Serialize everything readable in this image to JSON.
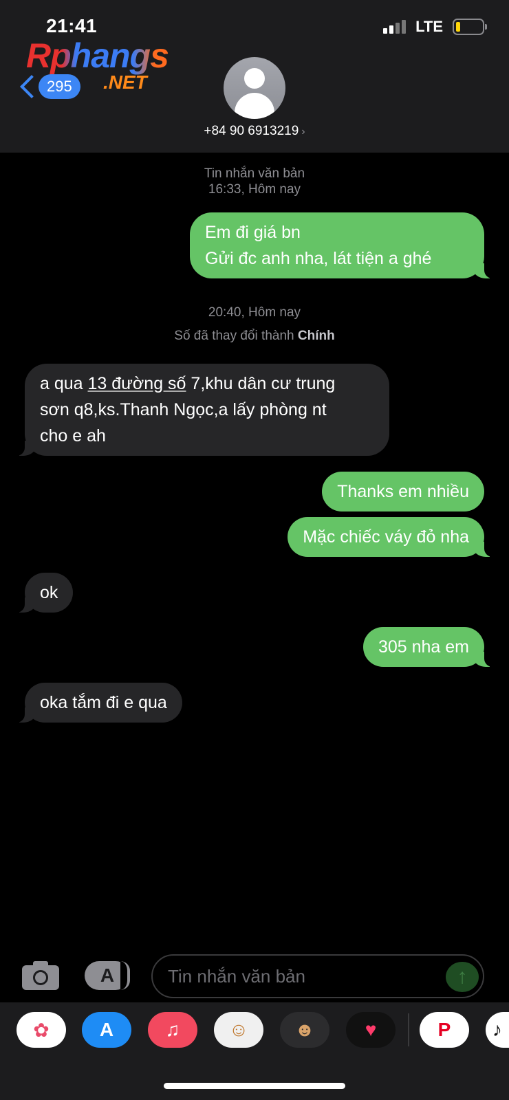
{
  "status_bar": {
    "time": "21:41",
    "network": "LTE"
  },
  "header": {
    "logo_main": "Rphangs",
    "logo_sub": ".NET",
    "back_badge": "295",
    "contact_number": "+84 90 6913219",
    "contact_arrow": "›"
  },
  "messages": {
    "meta1_line1": "Tin nhắn văn bản",
    "meta1_line2": "16:33, Hôm nay",
    "m1_line1": "Em đi giá bn",
    "m1_line2": "Gửi đc anh nha, lát tiện a ghé",
    "meta2_time": "20:40, Hôm nay",
    "meta2_prefix": "Số đã thay đổi thành ",
    "meta2_bold": "Chính",
    "m2_part1": "a qua ",
    "m2_link": "13 đường số",
    "m2_part2": " 7,khu dân cư trung",
    "m2_line2": "sơn q8,ks.Thanh Ngọc,a lấy phòng nt",
    "m2_line3": "cho e ah",
    "m3": "Thanks em nhiều",
    "m4": "Mặc chiếc váy đỏ nha",
    "m5": "ok",
    "m6": "305 nha em",
    "m7": "oka tắm đi e qua"
  },
  "input_bar": {
    "placeholder": "Tin nhắn văn bản",
    "send_glyph": "↑",
    "apps_glyph": "A"
  },
  "app_drawer": [
    {
      "name": "photos-app",
      "glyph": "✿"
    },
    {
      "name": "app-store-app",
      "glyph": "A"
    },
    {
      "name": "music-app",
      "glyph": "♫"
    },
    {
      "name": "memoji-stickers-app",
      "glyph": "☺"
    },
    {
      "name": "memoji-app",
      "glyph": "☻"
    },
    {
      "name": "digital-touch-app",
      "glyph": "♥"
    },
    {
      "name": "pinterest-app",
      "glyph": "P"
    },
    {
      "name": "tiktok-app",
      "glyph": "♪"
    }
  ],
  "colors": {
    "sent_bubble": "#65c466",
    "received_bubble": "#262628",
    "accent_blue": "#3c86f5",
    "header_bg": "#1c1c1e"
  }
}
